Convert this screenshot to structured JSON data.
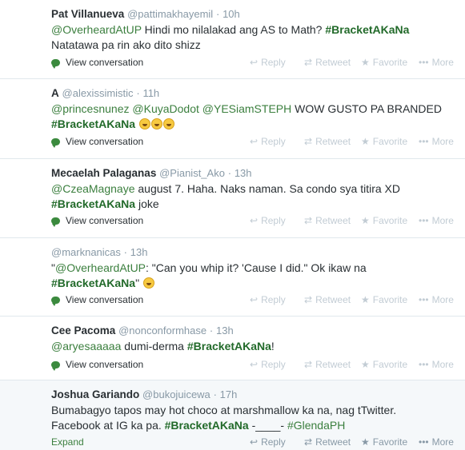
{
  "tweets": [
    {
      "name": "Pat Villanueva",
      "handle": "@pattimakhayemil",
      "time": "10h",
      "line1": [
        "@OverheardAtUP",
        " Hindi mo nilalakad ang AS to Math? ",
        "#BracketAKaNa"
      ],
      "line2": "Natatawa pa rin ako dito shizz",
      "footer_link": "View conversation"
    },
    {
      "name": "A",
      "handle": "@alexissimistic",
      "time": "11h",
      "line1": [
        "@princesnunez",
        " ",
        "@KuyaDodot",
        " ",
        "@YESiamSTEPH",
        " WOW GUSTO PA BRANDED"
      ],
      "line2_tag": "#BracketAKaNa",
      "footer_link": "View conversation"
    },
    {
      "name": "Mecaelah Palaganas",
      "handle": "@Pianist_Ako",
      "time": "13h",
      "line1": [
        "@CzeaMagnaye",
        " august 7. Haha. Naks naman. Sa condo sya titira XD"
      ],
      "line2_tag": "#BracketAKaNa",
      "line2_rest": " joke",
      "footer_link": "View conversation"
    },
    {
      "name": "",
      "handle": "@marknanicas",
      "time": "13h",
      "line1": [
        "\"",
        "@OverheardAtUP",
        ": \"Can you whip it? 'Cause I did.\" Ok ikaw na"
      ],
      "line2_tag": "#BracketAKaNa",
      "line2_rest": "\"",
      "footer_link": "View conversation"
    },
    {
      "name": "Cee Pacoma",
      "handle": "@nonconformhase",
      "time": "13h",
      "line1": [
        "@aryesaaaaa",
        " dumi-derma ",
        "#BracketAKaNa",
        "!"
      ],
      "footer_link": "View conversation"
    },
    {
      "name": "Joshua Gariando",
      "handle": "@bukojuicewa",
      "time": "17h",
      "line1": "Bumabagyo tapos may hot choco at marshmallow ka na, nag tTwitter.",
      "line2": [
        "Facebook at IG ka pa. ",
        "#BracketAKaNa",
        " -____- ",
        "#GlendaPH"
      ],
      "footer_link": "Expand"
    }
  ],
  "actions": {
    "reply": "Reply",
    "retweet": "Retweet",
    "favorite": "Favorite",
    "more": "More"
  },
  "icons": {
    "reply": "reply-icon",
    "retweet": "retweet-icon",
    "favorite": "star-icon",
    "more": "more-dots-icon",
    "conversation": "speech-bubble-icon",
    "emoji": "tears-of-joy-emoji"
  },
  "colors": {
    "hashtag": "#226a2a",
    "mention": "#3b7f3e",
    "muted": "#8899a6",
    "divider": "#e1e8ed",
    "highlight_bg": "#f5f8fa"
  }
}
